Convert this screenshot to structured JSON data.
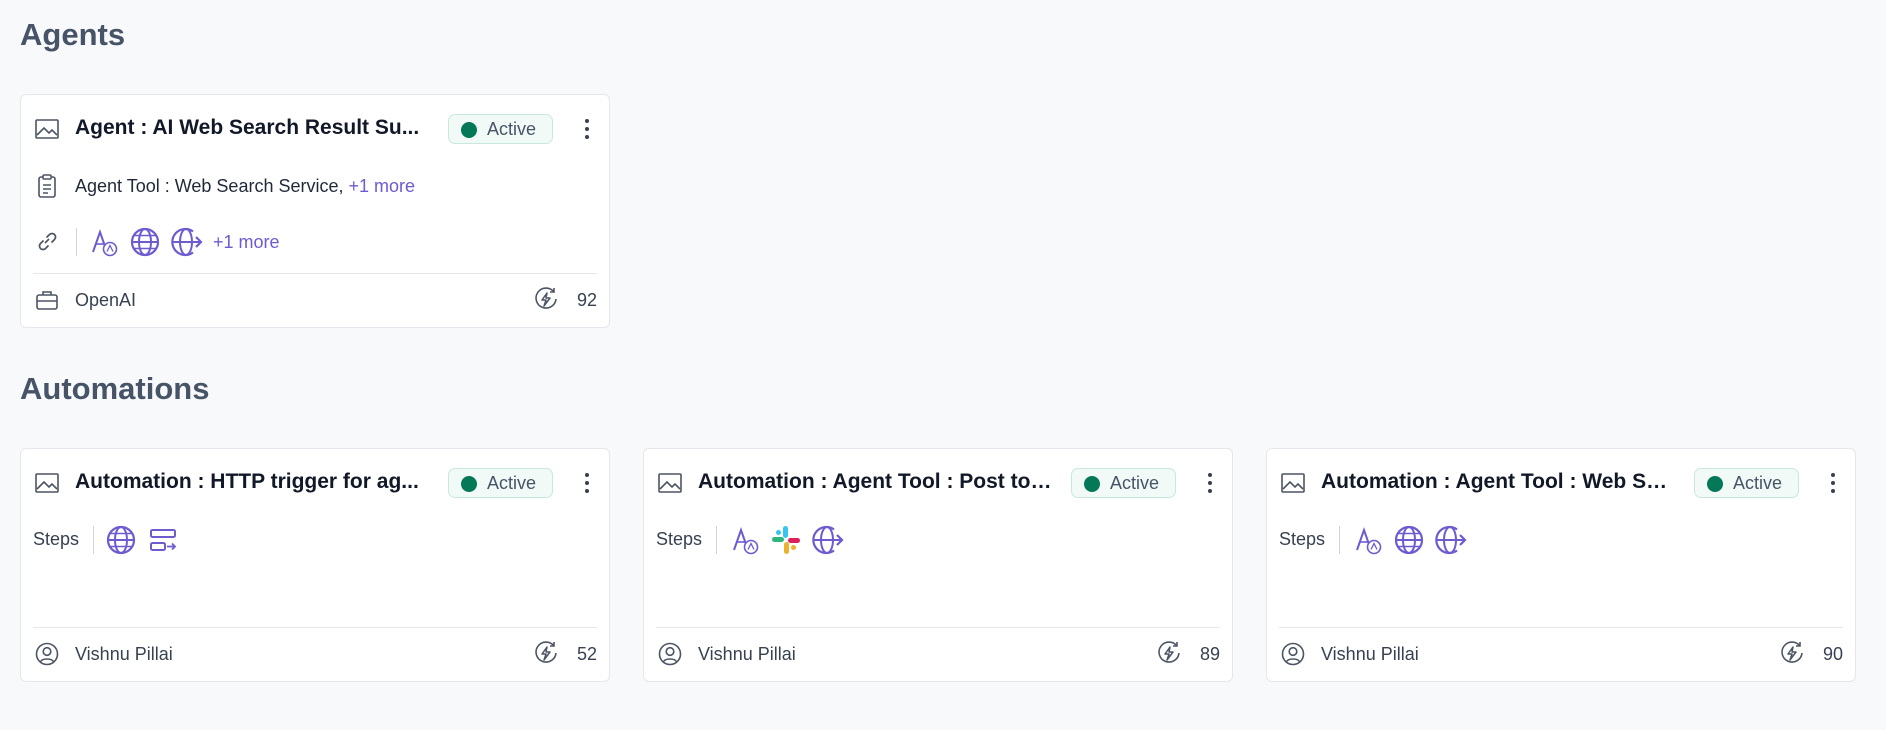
{
  "sections": {
    "agents_title": "Agents",
    "automations_title": "Automations"
  },
  "agent_card": {
    "title": "Agent : AI Web Search Result Su...",
    "status": "Active",
    "tool_text": "Agent Tool : Web Search Service,",
    "tool_more": " +1 more",
    "apps_more": "+1 more",
    "provider": "OpenAI",
    "count": "92"
  },
  "automation_cards": [
    {
      "title": "Automation : HTTP trigger for ag...",
      "status": "Active",
      "steps_label": "Steps",
      "owner": "Vishnu Pillai",
      "count": "52"
    },
    {
      "title": "Automation : Agent Tool : Post to ...",
      "status": "Active",
      "steps_label": "Steps",
      "owner": "Vishnu Pillai",
      "count": "89"
    },
    {
      "title": "Automation : Agent Tool : Web Se...",
      "status": "Active",
      "steps_label": "Steps",
      "owner": "Vishnu Pillai",
      "count": "90"
    }
  ],
  "colors": {
    "accent": "#6d5bd0",
    "active": "#047857",
    "heading": "#475467"
  }
}
